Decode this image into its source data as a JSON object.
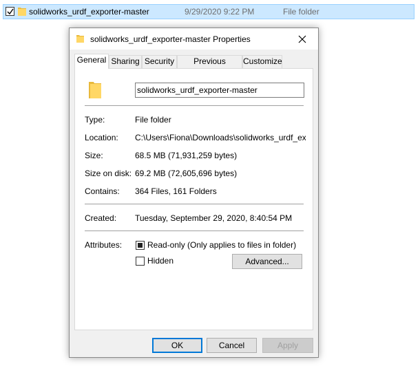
{
  "explorer_row": {
    "name": "solidworks_urdf_exporter-master",
    "date": "9/29/2020 9:22 PM",
    "type": "File folder"
  },
  "dialog": {
    "title": "solidworks_urdf_exporter-master Properties",
    "tabs": [
      {
        "label": "General",
        "active": true
      },
      {
        "label": "Sharing"
      },
      {
        "label": "Security"
      },
      {
        "label": "Previous Versions"
      },
      {
        "label": "Customize"
      }
    ],
    "folder_name": "solidworks_urdf_exporter-master",
    "fields": {
      "type_label": "Type:",
      "type_value": "File folder",
      "location_label": "Location:",
      "location_value": "C:\\Users\\Fiona\\Downloads\\solidworks_urdf_exporter",
      "size_label": "Size:",
      "size_value": "68.5 MB (71,931,259 bytes)",
      "size_on_disk_label": "Size on disk:",
      "size_on_disk_value": "69.2 MB (72,605,696 bytes)",
      "contains_label": "Contains:",
      "contains_value": "364 Files, 161 Folders",
      "created_label": "Created:",
      "created_value": "Tuesday, September 29, 2020, 8:40:54 PM"
    },
    "attributes": {
      "label": "Attributes:",
      "readonly_label": "Read-only (Only applies to files in folder)",
      "readonly_state": "indeterminate",
      "hidden_label": "Hidden",
      "hidden_checked": false,
      "advanced_label": "Advanced..."
    },
    "buttons": {
      "ok": "OK",
      "cancel": "Cancel",
      "apply": "Apply"
    }
  },
  "colors": {
    "selection_bg": "#cce8ff",
    "folder_yellow": "#ffd766",
    "accent": "#0078d7"
  }
}
